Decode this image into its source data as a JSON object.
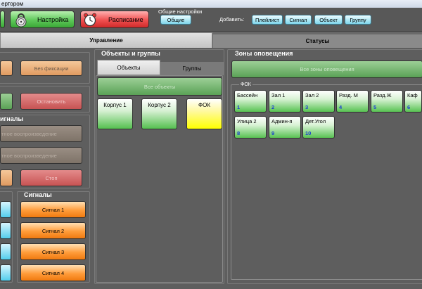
{
  "window": {
    "title": "ертором"
  },
  "toolbar": {
    "settings_label": "Настройка",
    "schedule_label": "Расписание",
    "general_settings_caption": "Общие настройки",
    "general_button": "Общие",
    "add_caption": "Добавить:",
    "add_buttons": [
      "Плейлист",
      "Сигнал",
      "Объект",
      "Группу"
    ]
  },
  "tabs": {
    "control": "Управление",
    "statuses": "Статусы"
  },
  "left": {
    "no_fix_button": "Без фиксации",
    "stop_button_1": "Остановить",
    "signals_section_partial": "игналы",
    "playback_1": "тное воспроизведение",
    "playback_2": "тное воспроизведение",
    "stop_button_2": "Стоп",
    "signals_title": "Сигналы",
    "signals": [
      "Сигнал 1",
      "Сигнал 2",
      "Сигнал 3",
      "Сигнал 4"
    ]
  },
  "objects": {
    "title": "Объекты и группы",
    "tab_objects": "Объекты",
    "tab_groups": "Группы",
    "all_objects": "Все объекты",
    "items": [
      {
        "label": "Корпус 1",
        "color": "green"
      },
      {
        "label": "Корпус 2",
        "color": "green"
      },
      {
        "label": "ФОК",
        "color": "yellow"
      }
    ]
  },
  "zones": {
    "title": "Зоны оповещения",
    "all_zones": "Все зоны оповещения",
    "group_label": "ФОК",
    "items": [
      {
        "label": "Бассейн",
        "num": "1"
      },
      {
        "label": "Зал 1",
        "num": "2"
      },
      {
        "label": "Зал 2",
        "num": "3"
      },
      {
        "label": "Разд. М",
        "num": "4"
      },
      {
        "label": "Разд.Ж",
        "num": "5"
      },
      {
        "label": "Каф",
        "num": "6"
      },
      {
        "label": "Улица 2",
        "num": "8"
      },
      {
        "label": "Админ-я",
        "num": "9"
      },
      {
        "label": "Дет.Угол",
        "num": "10"
      }
    ]
  },
  "colors": {
    "accent_green": "#5fc85a",
    "accent_red": "#f05050",
    "accent_orange": "#ff9c3a",
    "selected_yellow": "#ffff00",
    "zone_number": "#1a3fd0"
  }
}
